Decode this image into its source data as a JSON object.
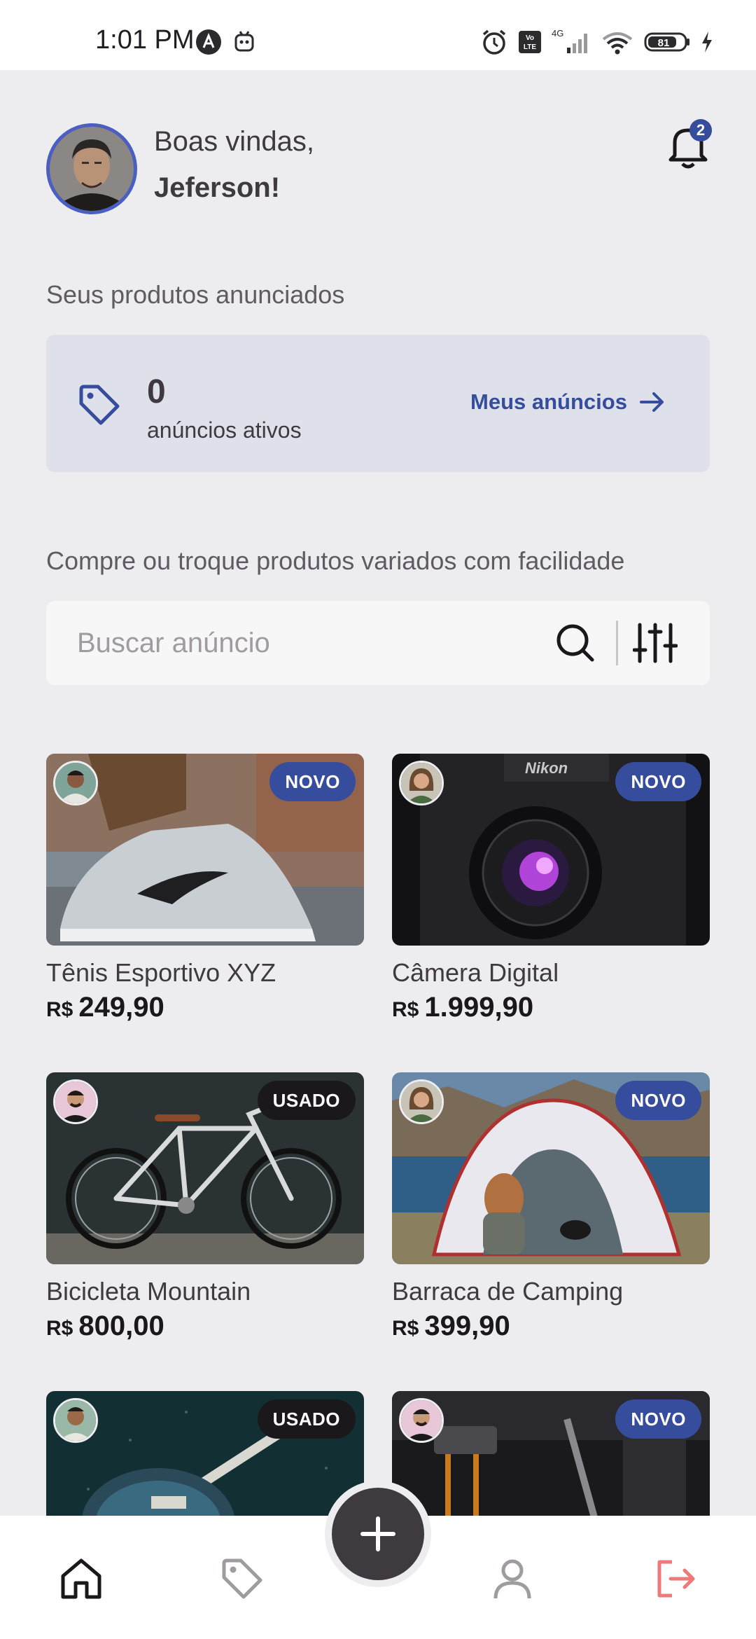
{
  "status_bar": {
    "time": "1:01 PM",
    "battery": "81"
  },
  "header": {
    "greeting": "Boas vindas,",
    "user_name": "Jeferson!",
    "notification_count": "2"
  },
  "my_products": {
    "section_label": "Seus produtos anunciados",
    "active_count": "0",
    "active_label": "anúncios ativos",
    "link_label": "Meus anúncios"
  },
  "shop": {
    "section_label": "Compre ou troque produtos variados com facilidade",
    "search_placeholder": "Buscar anúncio"
  },
  "products": [
    {
      "name": "Tênis Esportivo XYZ",
      "currency": "R$",
      "price": "249,90",
      "condition": "NOVO"
    },
    {
      "name": "Câmera Digital",
      "currency": "R$",
      "price": "1.999,90",
      "condition": "NOVO"
    },
    {
      "name": "Bicicleta Mountain",
      "currency": "R$",
      "price": "800,00",
      "condition": "USADO"
    },
    {
      "name": "Barraca de Camping",
      "currency": "R$",
      "price": "399,90",
      "condition": "NOVO"
    },
    {
      "name": "",
      "currency": "",
      "price": "",
      "condition": "USADO"
    },
    {
      "name": "",
      "currency": "",
      "price": "",
      "condition": "NOVO"
    }
  ],
  "nav": {
    "items": [
      "home-icon",
      "tag-icon",
      "plus-icon",
      "user-icon",
      "sign-out-icon"
    ]
  },
  "colors": {
    "accent": "#364D9D",
    "background": "#EDEDEF",
    "dark": "#1A181B",
    "danger": "#EE7979"
  }
}
